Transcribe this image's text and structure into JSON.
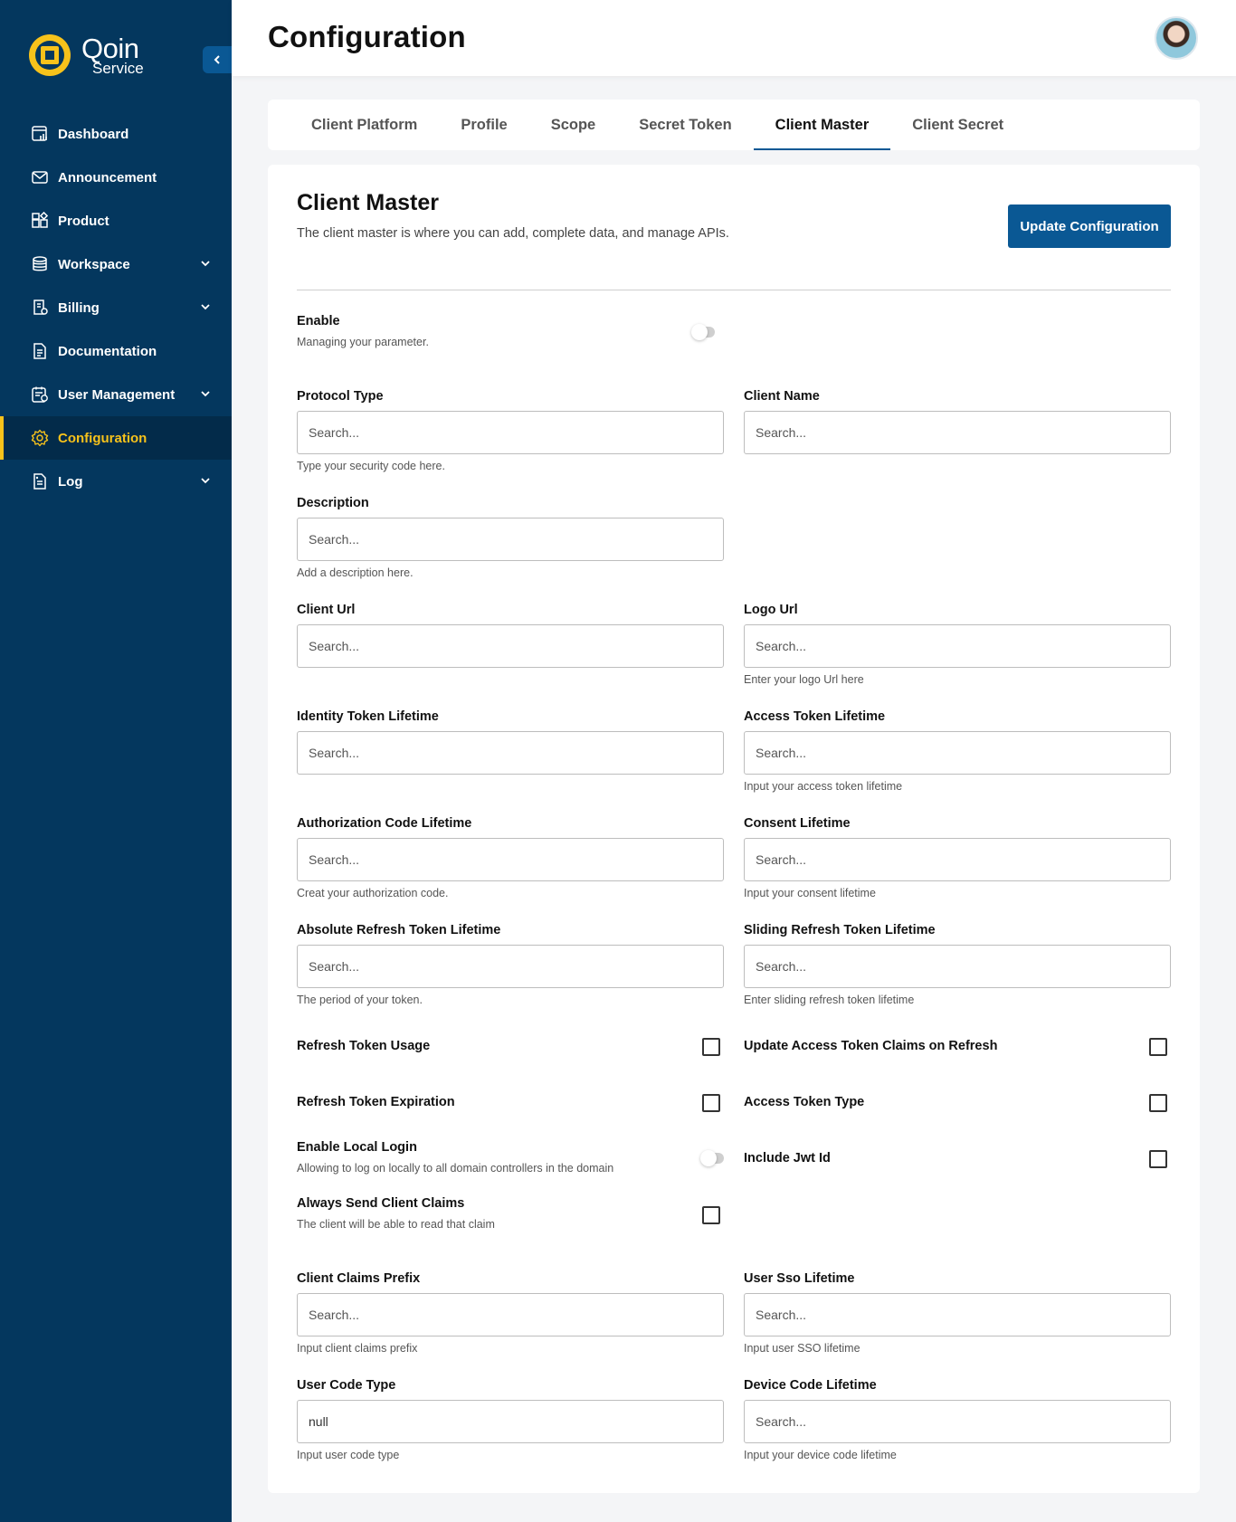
{
  "brand": {
    "name": "Qoin",
    "sub": "Service",
    "icon": "qoin-logo-icon"
  },
  "sidebar": {
    "collapse_icon": "chevron-left-icon",
    "items": [
      {
        "label": "Dashboard",
        "icon": "dashboard-icon"
      },
      {
        "label": "Announcement",
        "icon": "mail-icon"
      },
      {
        "label": "Product",
        "icon": "product-icon"
      },
      {
        "label": "Workspace",
        "icon": "database-icon",
        "has_chevron": true
      },
      {
        "label": "Billing",
        "icon": "billing-icon",
        "has_chevron": true
      },
      {
        "label": "Documentation",
        "icon": "document-icon"
      },
      {
        "label": "User Management",
        "icon": "user-management-icon",
        "has_chevron": true
      },
      {
        "label": "Configuration",
        "icon": "gear-icon",
        "active": true
      },
      {
        "label": "Log",
        "icon": "log-icon",
        "has_chevron": true
      }
    ]
  },
  "header": {
    "title": "Configuration"
  },
  "tabs": [
    {
      "label": "Client Platform"
    },
    {
      "label": "Profile"
    },
    {
      "label": "Scope"
    },
    {
      "label": "Secret Token"
    },
    {
      "label": "Client Master",
      "active": true
    },
    {
      "label": "Client Secret"
    }
  ],
  "card": {
    "title": "Client Master",
    "description": "The client master  is where you can add, complete data, and manage APIs.",
    "update_button": "Update Configuration"
  },
  "form": {
    "enable": {
      "label": "Enable",
      "sub": "Managing your parameter.",
      "on": false
    },
    "protocol_type": {
      "label": "Protocol Type",
      "placeholder": "Search...",
      "help": "Type your security code here."
    },
    "client_name": {
      "label": "Client Name",
      "placeholder": "Search..."
    },
    "description": {
      "label": "Description",
      "placeholder": "Search...",
      "help": "Add a description here."
    },
    "client_url": {
      "label": "Client Url",
      "placeholder": "Search..."
    },
    "logo_url": {
      "label": "Logo Url",
      "placeholder": "Search...",
      "help": "Enter your logo Url here"
    },
    "identity_token_lifetime": {
      "label": "Identity Token Lifetime",
      "placeholder": "Search..."
    },
    "access_token_lifetime": {
      "label": "Access Token Lifetime",
      "placeholder": "Search...",
      "help": "Input your access token lifetime"
    },
    "authorization_code_lifetime": {
      "label": "Authorization Code Lifetime",
      "placeholder": "Search...",
      "help": "Creat your authorization code."
    },
    "consent_lifetime": {
      "label": "Consent Lifetime",
      "placeholder": "Search...",
      "help": "Input your consent lifetime"
    },
    "absolute_refresh_token_lifetime": {
      "label": "Absolute Refresh Token Lifetime",
      "placeholder": "Search...",
      "help": "The period of your token."
    },
    "sliding_refresh_token_lifetime": {
      "label": "Sliding Refresh Token Lifetime",
      "placeholder": "Search...",
      "help": "Enter sliding refresh token lifetime"
    },
    "refresh_token_usage": {
      "label": "Refresh Token Usage",
      "checked": false
    },
    "update_access_token_claims": {
      "label": "Update Access Token Claims on Refresh",
      "checked": false
    },
    "refresh_token_expiration": {
      "label": "Refresh Token Expiration",
      "checked": false
    },
    "access_token_type": {
      "label": "Access Token Type",
      "checked": false
    },
    "enable_local_login": {
      "label": "Enable Local Login",
      "sub": "Allowing to log on locally to all domain controllers in the domain",
      "on": false
    },
    "include_jwt_id": {
      "label": "Include Jwt Id",
      "checked": false
    },
    "always_send_client_claims": {
      "label": "Always Send Client Claims",
      "sub": "The client will be able to read that claim",
      "checked": false
    },
    "client_claims_prefix": {
      "label": "Client Claims Prefix",
      "placeholder": "Search...",
      "help": "Input client claims prefix"
    },
    "user_sso_lifetime": {
      "label": "User Sso Lifetime",
      "placeholder": "Search...",
      "help": "Input user SSO lifetime"
    },
    "user_code_type": {
      "label": "User Code Type",
      "value": "null",
      "help": "Input user code type"
    },
    "device_code_lifetime": {
      "label": "Device Code Lifetime",
      "placeholder": "Search...",
      "help": "Input your device code lifetime"
    }
  },
  "colors": {
    "sidebar_bg": "#04375e",
    "accent": "#0a5894",
    "active": "#f7c21b"
  }
}
